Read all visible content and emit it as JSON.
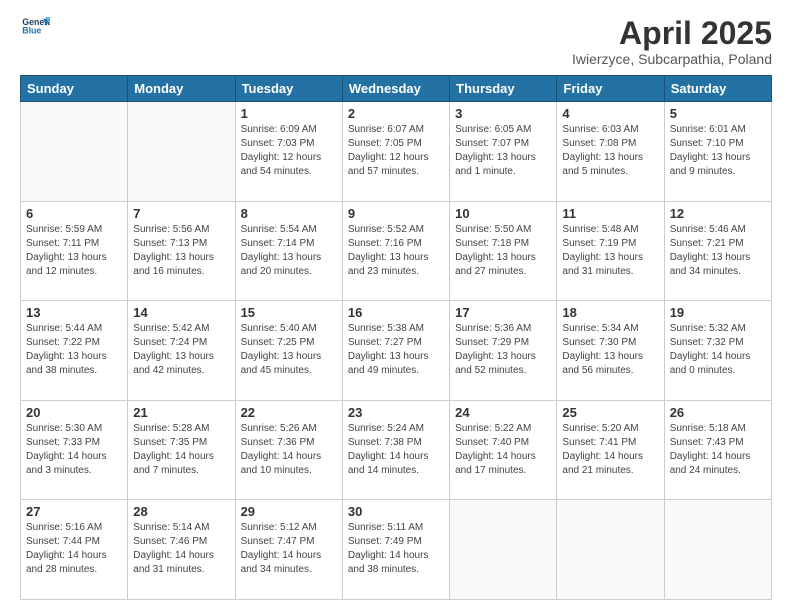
{
  "logo": {
    "line1": "General",
    "line2": "Blue"
  },
  "title": "April 2025",
  "subtitle": "Iwierzyce, Subcarpathia, Poland",
  "days_header": [
    "Sunday",
    "Monday",
    "Tuesday",
    "Wednesday",
    "Thursday",
    "Friday",
    "Saturday"
  ],
  "weeks": [
    [
      {
        "day": "",
        "info": ""
      },
      {
        "day": "",
        "info": ""
      },
      {
        "day": "1",
        "info": "Sunrise: 6:09 AM\nSunset: 7:03 PM\nDaylight: 12 hours\nand 54 minutes."
      },
      {
        "day": "2",
        "info": "Sunrise: 6:07 AM\nSunset: 7:05 PM\nDaylight: 12 hours\nand 57 minutes."
      },
      {
        "day": "3",
        "info": "Sunrise: 6:05 AM\nSunset: 7:07 PM\nDaylight: 13 hours\nand 1 minute."
      },
      {
        "day": "4",
        "info": "Sunrise: 6:03 AM\nSunset: 7:08 PM\nDaylight: 13 hours\nand 5 minutes."
      },
      {
        "day": "5",
        "info": "Sunrise: 6:01 AM\nSunset: 7:10 PM\nDaylight: 13 hours\nand 9 minutes."
      }
    ],
    [
      {
        "day": "6",
        "info": "Sunrise: 5:59 AM\nSunset: 7:11 PM\nDaylight: 13 hours\nand 12 minutes."
      },
      {
        "day": "7",
        "info": "Sunrise: 5:56 AM\nSunset: 7:13 PM\nDaylight: 13 hours\nand 16 minutes."
      },
      {
        "day": "8",
        "info": "Sunrise: 5:54 AM\nSunset: 7:14 PM\nDaylight: 13 hours\nand 20 minutes."
      },
      {
        "day": "9",
        "info": "Sunrise: 5:52 AM\nSunset: 7:16 PM\nDaylight: 13 hours\nand 23 minutes."
      },
      {
        "day": "10",
        "info": "Sunrise: 5:50 AM\nSunset: 7:18 PM\nDaylight: 13 hours\nand 27 minutes."
      },
      {
        "day": "11",
        "info": "Sunrise: 5:48 AM\nSunset: 7:19 PM\nDaylight: 13 hours\nand 31 minutes."
      },
      {
        "day": "12",
        "info": "Sunrise: 5:46 AM\nSunset: 7:21 PM\nDaylight: 13 hours\nand 34 minutes."
      }
    ],
    [
      {
        "day": "13",
        "info": "Sunrise: 5:44 AM\nSunset: 7:22 PM\nDaylight: 13 hours\nand 38 minutes."
      },
      {
        "day": "14",
        "info": "Sunrise: 5:42 AM\nSunset: 7:24 PM\nDaylight: 13 hours\nand 42 minutes."
      },
      {
        "day": "15",
        "info": "Sunrise: 5:40 AM\nSunset: 7:25 PM\nDaylight: 13 hours\nand 45 minutes."
      },
      {
        "day": "16",
        "info": "Sunrise: 5:38 AM\nSunset: 7:27 PM\nDaylight: 13 hours\nand 49 minutes."
      },
      {
        "day": "17",
        "info": "Sunrise: 5:36 AM\nSunset: 7:29 PM\nDaylight: 13 hours\nand 52 minutes."
      },
      {
        "day": "18",
        "info": "Sunrise: 5:34 AM\nSunset: 7:30 PM\nDaylight: 13 hours\nand 56 minutes."
      },
      {
        "day": "19",
        "info": "Sunrise: 5:32 AM\nSunset: 7:32 PM\nDaylight: 14 hours\nand 0 minutes."
      }
    ],
    [
      {
        "day": "20",
        "info": "Sunrise: 5:30 AM\nSunset: 7:33 PM\nDaylight: 14 hours\nand 3 minutes."
      },
      {
        "day": "21",
        "info": "Sunrise: 5:28 AM\nSunset: 7:35 PM\nDaylight: 14 hours\nand 7 minutes."
      },
      {
        "day": "22",
        "info": "Sunrise: 5:26 AM\nSunset: 7:36 PM\nDaylight: 14 hours\nand 10 minutes."
      },
      {
        "day": "23",
        "info": "Sunrise: 5:24 AM\nSunset: 7:38 PM\nDaylight: 14 hours\nand 14 minutes."
      },
      {
        "day": "24",
        "info": "Sunrise: 5:22 AM\nSunset: 7:40 PM\nDaylight: 14 hours\nand 17 minutes."
      },
      {
        "day": "25",
        "info": "Sunrise: 5:20 AM\nSunset: 7:41 PM\nDaylight: 14 hours\nand 21 minutes."
      },
      {
        "day": "26",
        "info": "Sunrise: 5:18 AM\nSunset: 7:43 PM\nDaylight: 14 hours\nand 24 minutes."
      }
    ],
    [
      {
        "day": "27",
        "info": "Sunrise: 5:16 AM\nSunset: 7:44 PM\nDaylight: 14 hours\nand 28 minutes."
      },
      {
        "day": "28",
        "info": "Sunrise: 5:14 AM\nSunset: 7:46 PM\nDaylight: 14 hours\nand 31 minutes."
      },
      {
        "day": "29",
        "info": "Sunrise: 5:12 AM\nSunset: 7:47 PM\nDaylight: 14 hours\nand 34 minutes."
      },
      {
        "day": "30",
        "info": "Sunrise: 5:11 AM\nSunset: 7:49 PM\nDaylight: 14 hours\nand 38 minutes."
      },
      {
        "day": "",
        "info": ""
      },
      {
        "day": "",
        "info": ""
      },
      {
        "day": "",
        "info": ""
      }
    ]
  ]
}
